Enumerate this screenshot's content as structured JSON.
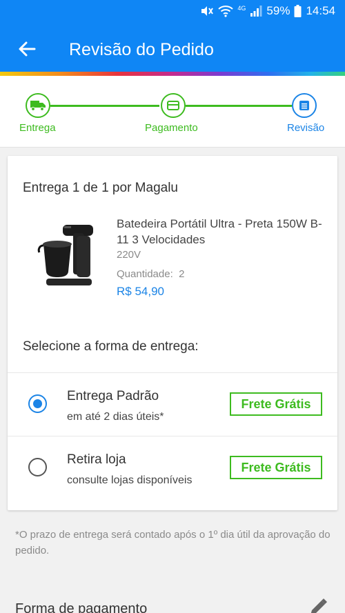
{
  "status": {
    "battery": "59%",
    "time": "14:54",
    "network": "4G"
  },
  "header": {
    "title": "Revisão do Pedido"
  },
  "stepper": {
    "steps": [
      {
        "label": "Entrega"
      },
      {
        "label": "Pagamento"
      },
      {
        "label": "Revisão"
      }
    ]
  },
  "delivery": {
    "title": "Entrega 1 de 1 por Magalu",
    "product": {
      "name": "Batedeira Portátil Ultra - Preta 150W B-11 3 Velocidades",
      "voltage": "220V",
      "quantity": "Quantidade:  2",
      "price": "R$ 54,90"
    },
    "select_title": "Selecione a forma de entrega:",
    "options": [
      {
        "title": "Entrega Padrão",
        "subtitle": "em até 2 dias úteis*",
        "badge": "Frete Grátis",
        "selected": true
      },
      {
        "title": "Retira loja",
        "subtitle": "consulte lojas disponíveis",
        "badge": "Frete Grátis",
        "selected": false
      }
    ]
  },
  "note": "*O prazo de entrega será contado após o 1º dia útil da aprovação do pedido.",
  "payment": {
    "title": "Forma de pagamento"
  },
  "colors": {
    "primary": "#0f86f5",
    "green": "#3dbb1f",
    "link_blue": "#1b84e6"
  }
}
